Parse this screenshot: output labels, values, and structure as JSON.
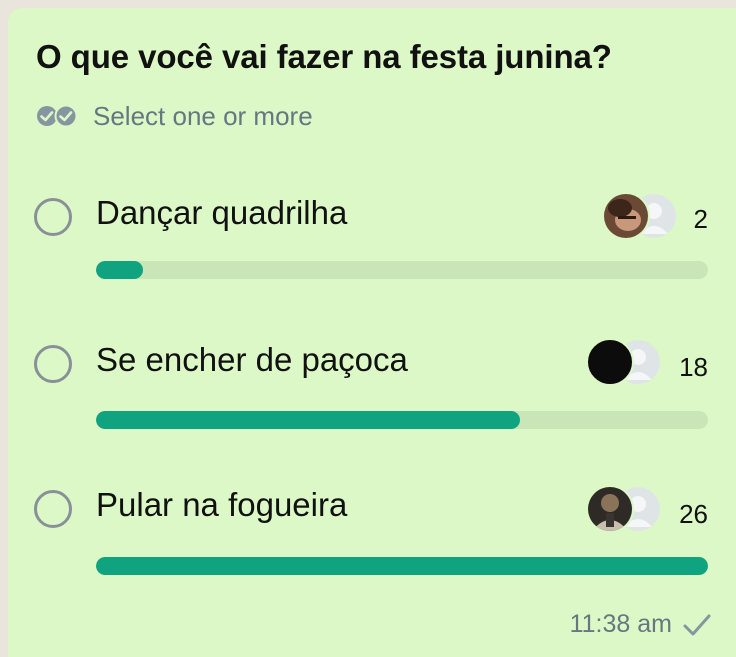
{
  "poll": {
    "question": "O que você vai fazer na festa junina?",
    "select_hint": "Select one or more",
    "options": [
      {
        "label": "Dançar quadrilha",
        "votes": "2",
        "fill_fraction": 0.077,
        "avatar_style": "photo-light"
      },
      {
        "label": "Se encher de paçoca",
        "votes": "18",
        "fill_fraction": 0.692,
        "avatar_style": "dark"
      },
      {
        "label": "Pular na fogueira",
        "votes": "26",
        "fill_fraction": 1.0,
        "avatar_style": "photo-dark"
      }
    ]
  },
  "footer": {
    "time": "11:38 am",
    "status_icon": "single-check-icon"
  },
  "colors": {
    "bubble_bg": "#dcf8c6",
    "bar_fill": "#0fa37f",
    "bar_track": "#c8e6b8",
    "muted_text": "#667781",
    "radio_border": "#8a9097"
  },
  "icons": {
    "select_hint": "double-check-circles-icon",
    "default_avatar": "default-user-icon"
  }
}
